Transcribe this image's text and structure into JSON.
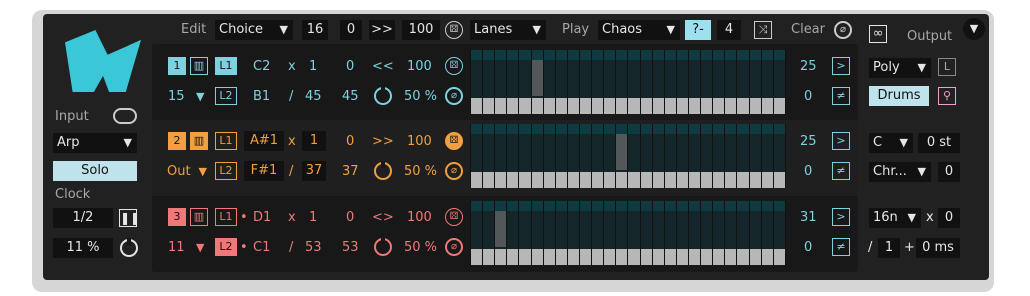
{
  "colors": {
    "cyan": "#7fd1e0",
    "orange": "#f0a040",
    "red": "#f07878",
    "hl_blue": "#9fe0ee"
  },
  "top": {
    "edit_label": "Edit",
    "edit_mode": "Choice",
    "steps": "16",
    "offset": "0",
    "direction": ">>",
    "probability": "100",
    "lanes_mode": "Lanes",
    "play_label": "Play",
    "play_mode": "Chaos",
    "toggle": "?-",
    "count": "4",
    "clear_label": "Clear",
    "output_label": "Output"
  },
  "left": {
    "logo": "A",
    "input_label": "Input",
    "input_mode": "Arp",
    "solo_label": "Solo",
    "clock_label": "Clock",
    "clock_rate": "1/2",
    "swing": "11 %"
  },
  "rows": [
    {
      "num": "1",
      "l1": "L1",
      "l2": "L2",
      "note1": "C2",
      "note2": "B1",
      "mult": "x",
      "div": "/",
      "mult_val": "1",
      "div_val": "45",
      "offset": "0",
      "offset2": "45",
      "dir": "<<",
      "prob": "100",
      "pct": "50 %",
      "channel": "15",
      "dot": "",
      "lane_val1": "25",
      "lane_val2": "0",
      "btn1": ">",
      "btn2": "≠",
      "highlight": [
        5
      ]
    },
    {
      "num": "2",
      "l1": "L1",
      "l2": "L2",
      "note1": "A#1",
      "note2": "F#1",
      "mult": "x",
      "div": "/",
      "mult_val": "1",
      "div_val": "37",
      "offset": "0",
      "offset2": "37",
      "dir": ">>",
      "prob": "100",
      "pct": "50 %",
      "channel": "Out",
      "dot": "",
      "lane_val1": "25",
      "lane_val2": "0",
      "btn1": ">",
      "btn2": "≠",
      "highlight": [
        12
      ]
    },
    {
      "num": "3",
      "l1": "L1",
      "l2": "L2",
      "note1": "D1",
      "note2": "C1",
      "mult": "x",
      "div": "/",
      "mult_val": "1",
      "div_val": "53",
      "offset": "0",
      "offset2": "53",
      "dir": "<>",
      "prob": "100",
      "pct": "50 %",
      "channel": "11",
      "dot": "•",
      "lane_val1": "31",
      "lane_val2": "0",
      "btn1": ">",
      "btn2": "≠",
      "highlight": [
        2
      ]
    }
  ],
  "right": {
    "poly": "Poly",
    "poly_l": "L",
    "drums": "Drums",
    "key": "C",
    "transpose": "0 st",
    "scale": "Chr...",
    "scale_val": "0",
    "grid": "16n",
    "grid_x": "x",
    "grid_mult": "0",
    "slash": "/",
    "grid_div": "1",
    "plus": "+",
    "delay": "0 ms"
  }
}
